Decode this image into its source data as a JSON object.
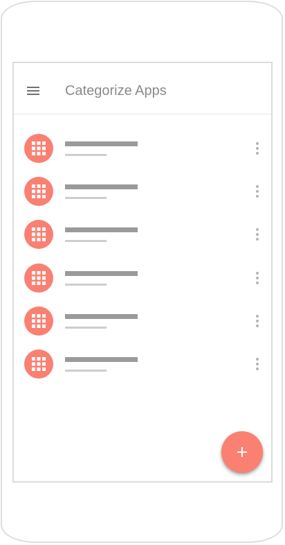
{
  "app_bar": {
    "title": "Categorize Apps",
    "menu_icon": "hamburger-menu-icon"
  },
  "list": {
    "items": [
      {
        "icon": "grid-apps-icon",
        "menu_icon": "more-vert-icon"
      },
      {
        "icon": "grid-apps-icon",
        "menu_icon": "more-vert-icon"
      },
      {
        "icon": "grid-apps-icon",
        "menu_icon": "more-vert-icon"
      },
      {
        "icon": "grid-apps-icon",
        "menu_icon": "more-vert-icon"
      },
      {
        "icon": "grid-apps-icon",
        "menu_icon": "more-vert-icon"
      },
      {
        "icon": "grid-apps-icon",
        "menu_icon": "more-vert-icon"
      }
    ]
  },
  "fab": {
    "icon": "plus-icon"
  },
  "colors": {
    "accent": "#fa8072",
    "title_text": "#8a8a8a",
    "placeholder_primary": "#9a9a9a",
    "placeholder_secondary": "#cdcdcd",
    "frame_border": "#dedede"
  }
}
